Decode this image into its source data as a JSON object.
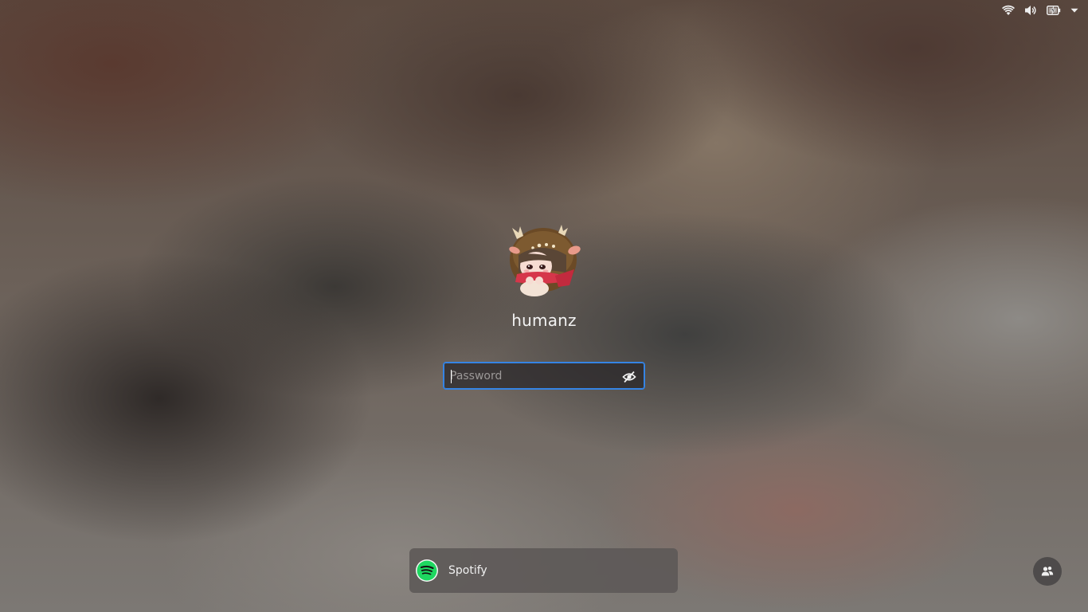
{
  "tray": {
    "icons": [
      "wifi-icon",
      "volume-icon",
      "battery-charging-icon",
      "menu-arrow-down-icon"
    ]
  },
  "login": {
    "username": "humanz",
    "password": {
      "placeholder": "Password",
      "value": ""
    },
    "peek_icon": "eye-slash-icon"
  },
  "notification": {
    "app_name": "Spotify",
    "icon": "spotify-icon",
    "accent": "#1ed760"
  },
  "switch_user": {
    "icon": "users-icon"
  },
  "colors": {
    "focus_ring": "#3584e4",
    "spotify_green": "#1ed760"
  }
}
